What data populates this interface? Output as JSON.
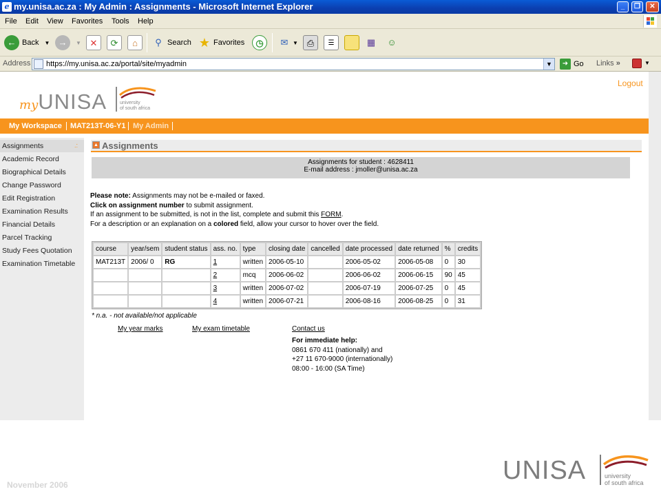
{
  "window": {
    "title": "my.unisa.ac.za : My Admin : Assignments - Microsoft Internet Explorer"
  },
  "menu": [
    "File",
    "Edit",
    "View",
    "Favorites",
    "Tools",
    "Help"
  ],
  "toolbar": {
    "back": "Back",
    "search": "Search",
    "favorites": "Favorites"
  },
  "address": {
    "label": "Address",
    "url": "https://my.unisa.ac.za/portal/site/myadmin",
    "go": "Go",
    "links": "Links"
  },
  "header": {
    "logout": "Logout",
    "logo_my": "my",
    "logo_unisa": "UNISA",
    "logo_tag1": "university",
    "logo_tag2": "of south africa"
  },
  "nav": {
    "workspace": "My Workspace",
    "course": "MAT213T-06-Y1",
    "admin": "My Admin"
  },
  "sidebar": {
    "items": [
      "Assignments",
      "Academic Record",
      "Biographical Details",
      "Change Password",
      "Edit Registration",
      "Examination Results",
      "Financial Details",
      "Parcel Tracking",
      "Study Fees Quotation",
      "Examination Timetable"
    ]
  },
  "assignments": {
    "title": "Assignments",
    "student_line": "Assignments for student : 4628411",
    "email_line": "E-mail address : jmoller@unisa.ac.za"
  },
  "notes": {
    "line1_bold": "Please note:",
    "line1_rest": " Assignments may not be e-mailed or faxed.",
    "line2_bold": "Click on assignment number",
    "line2_rest": " to submit assignment.",
    "line3_pre": "If an assignment to be submitted, is not in the list, complete and submit this ",
    "line3_link": "FORM",
    "line3_post": ".",
    "line4_pre": "For a description or an explanation on a ",
    "line4_bold": "colored",
    "line4_post": " field, allow your cursor to hover over the field."
  },
  "table": {
    "headers": [
      "course",
      "year/sem",
      "student status",
      "ass. no.",
      "type",
      "closing date",
      "cancelled",
      "date processed",
      "date returned",
      "%",
      "credits"
    ],
    "rows": [
      [
        "MAT213T",
        "2006/ 0",
        "RG",
        "1",
        "written",
        "2006-05-10",
        "",
        "2006-05-02",
        "2006-05-08",
        "0",
        "30"
      ],
      [
        "",
        "",
        "",
        "2",
        "mcq",
        "2006-06-02",
        "",
        "2006-06-02",
        "2006-06-15",
        "90",
        "45"
      ],
      [
        "",
        "",
        "",
        "3",
        "written",
        "2006-07-02",
        "",
        "2006-07-19",
        "2006-07-25",
        "0",
        "45"
      ],
      [
        "",
        "",
        "",
        "4",
        "written",
        "2006-07-21",
        "",
        "2006-08-16",
        "2006-08-25",
        "0",
        "31"
      ]
    ]
  },
  "footnote": "* n.a. - not available/not applicable",
  "footer_links": {
    "year_marks": "My year marks",
    "exam_timetable": "My exam timetable",
    "contact": "Contact us"
  },
  "help": {
    "title": "For immediate help:",
    "line1": "0861 670 411 (nationally) and",
    "line2": "+27 11 670-9000 (internationally)",
    "line3": "08:00 - 16:00 (SA Time)"
  },
  "slide": {
    "date": "November 2006",
    "logo": "UNISA",
    "tag1": "university",
    "tag2": "of south africa"
  },
  "colors": {
    "orange": "#f7941d",
    "xp_blue": "#0b3fb0"
  }
}
